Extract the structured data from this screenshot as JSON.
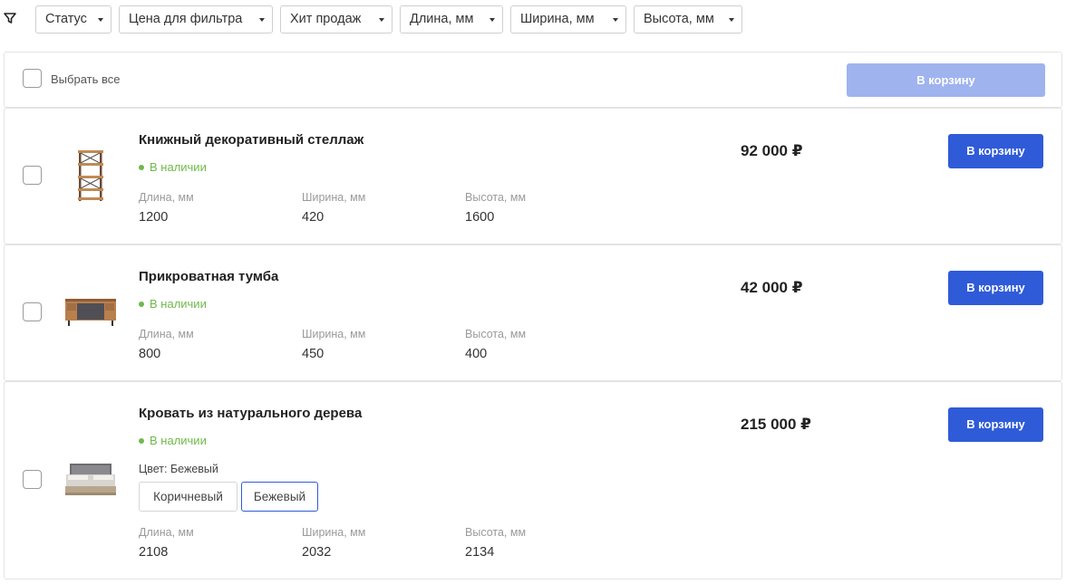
{
  "filters": [
    {
      "label": "Статус"
    },
    {
      "label": "Цена для фильтра"
    },
    {
      "label": "Хит продаж"
    },
    {
      "label": "Длина, мм"
    },
    {
      "label": "Ширина, мм"
    },
    {
      "label": "Высота, мм"
    }
  ],
  "select_all": {
    "label": "Выбрать все",
    "checked": false,
    "cart_button": "В корзину",
    "cart_button_enabled": false
  },
  "products": [
    {
      "name": "Книжный декоративный стеллаж",
      "stock": "В наличии",
      "price": "92 000 ₽",
      "cart_button": "В корзину",
      "checked": false,
      "image": "bookshelf-image",
      "specs": [
        {
          "label": "Длина, мм",
          "value": "1200"
        },
        {
          "label": "Ширина, мм",
          "value": "420"
        },
        {
          "label": "Высота, мм",
          "value": "1600"
        }
      ]
    },
    {
      "name": "Прикроватная тумба",
      "stock": "В наличии",
      "price": "42 000 ₽",
      "cart_button": "В корзину",
      "checked": false,
      "image": "nightstand-image",
      "specs": [
        {
          "label": "Длина, мм",
          "value": "800"
        },
        {
          "label": "Ширина, мм",
          "value": "450"
        },
        {
          "label": "Высота, мм",
          "value": "400"
        }
      ]
    },
    {
      "name": "Кровать из натурального дерева",
      "stock": "В наличии",
      "price": "215 000 ₽",
      "cart_button": "В корзину",
      "checked": false,
      "image": "bed-image",
      "color_label": "Цвет: Бежевый",
      "color_options": [
        {
          "label": "Коричневый",
          "selected": false
        },
        {
          "label": "Бежевый",
          "selected": true
        }
      ],
      "specs": [
        {
          "label": "Длина, мм",
          "value": "2108"
        },
        {
          "label": "Ширина, мм",
          "value": "2032"
        },
        {
          "label": "Высота, мм",
          "value": "2134"
        }
      ]
    }
  ],
  "colors": {
    "accent": "#2f5bd8",
    "accent_disabled": "#9fb3ef",
    "in_stock": "#6fb94a"
  }
}
